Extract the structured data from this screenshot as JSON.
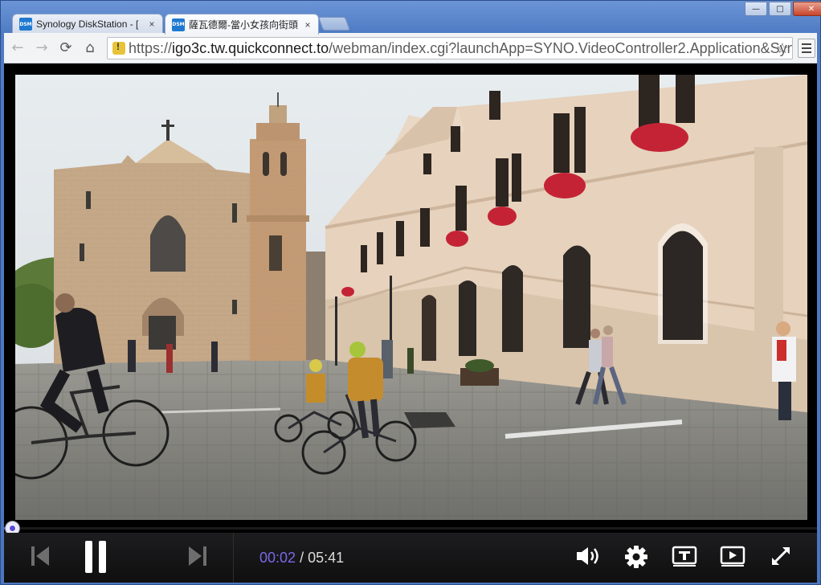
{
  "browser": {
    "tabs": [
      {
        "label": "Synology DiskStation - [",
        "favicon": "DSM",
        "active": false
      },
      {
        "label": "薩瓦德爾-當小女孩向街頭",
        "favicon": "DSM",
        "active": true
      }
    ],
    "tab_close_glyph": "×",
    "window_controls": {
      "minimize": "—",
      "maximize": "□",
      "close": "✕"
    },
    "nav": {
      "back": "←",
      "forward": "→",
      "reload": "⟳",
      "home": "⌂"
    },
    "url": {
      "scheme": "https://",
      "host": "igo3c.tw.quickconnect.to",
      "path": "/webman/index.cgi?launchApp=SYNO.VideoController2.Application&Syn"
    },
    "bookmark_icon": "☆"
  },
  "player": {
    "current_time": "00:02",
    "separator": "/",
    "total_time": "05:41",
    "progress_fraction": 0.006,
    "accent_color": "#6d5bd8",
    "icons": [
      "previous-icon",
      "pause-icon",
      "next-icon",
      "volume-icon",
      "settings-icon",
      "subtitle-icon",
      "play-to-device-icon",
      "fullscreen-icon"
    ]
  }
}
